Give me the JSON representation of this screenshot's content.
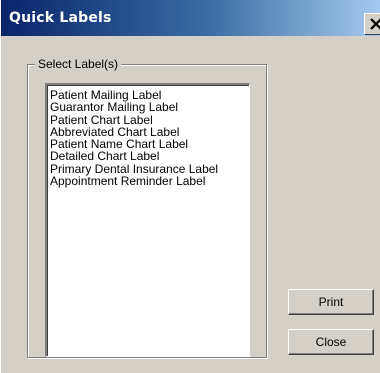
{
  "window": {
    "title": "Quick Labels"
  },
  "group": {
    "label": "Select Label(s)"
  },
  "labels": [
    "Patient Mailing Label",
    "Guarantor Mailing Label",
    "Patient Chart Label",
    "Abbreviated Chart Label",
    "Patient Name Chart Label",
    "Detailed Chart Label",
    "Primary Dental Insurance Label",
    "Appointment Reminder Label"
  ],
  "buttons": {
    "print_label": "Print",
    "close_label": "Close"
  },
  "icons": {
    "close": "close-icon"
  },
  "colors": {
    "titlebar_start": "#0a246a",
    "titlebar_end": "#a6caf0",
    "window_face": "#d4d0c8"
  }
}
